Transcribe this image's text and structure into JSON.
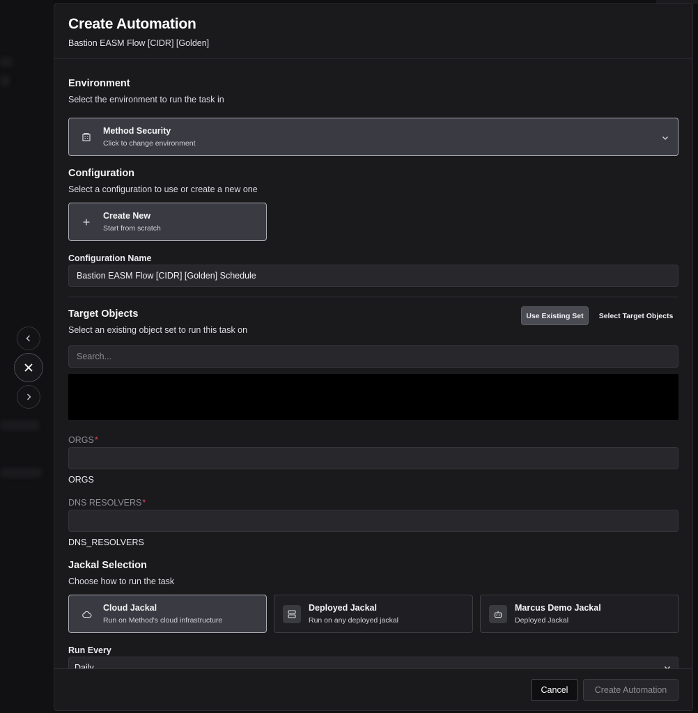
{
  "modal": {
    "title": "Create Automation",
    "subtitle": "Bastion EASM Flow [CIDR] [Golden]"
  },
  "environment": {
    "title": "Environment",
    "description": "Select the environment to run the task in",
    "selected_name": "Method Security",
    "selected_hint": "Click to change environment",
    "icon": "building-icon"
  },
  "configuration": {
    "title": "Configuration",
    "description": "Select a configuration to use or create a new one",
    "create_title": "Create New",
    "create_sub": "Start from scratch",
    "name_label": "Configuration Name",
    "name_value": "Bastion EASM Flow [CIDR] [Golden] Schedule"
  },
  "target_objects": {
    "title": "Target Objects",
    "description": "Select an existing object set to run this task on",
    "tab_existing": "Use Existing Set",
    "tab_select": "Select Target Objects",
    "search_placeholder": "Search..."
  },
  "params": {
    "orgs_label": "ORGS",
    "orgs_required": "*",
    "orgs_key": "ORGS",
    "dns_label": "DNS RESOLVERS",
    "dns_required": "*",
    "dns_key": "DNS_RESOLVERS"
  },
  "jackal": {
    "title": "Jackal Selection",
    "description": "Choose how to run the task",
    "options": [
      {
        "title": "Cloud Jackal",
        "sub": "Run on Method's cloud infrastructure",
        "icon": "cloud-icon"
      },
      {
        "title": "Deployed Jackal",
        "sub": "Run on any deployed jackal",
        "icon": "server-icon"
      },
      {
        "title": "Marcus Demo Jackal",
        "sub": "Deployed Jackal",
        "icon": "bot-icon"
      }
    ]
  },
  "schedule": {
    "label": "Run Every",
    "value": "Daily"
  },
  "footer": {
    "cancel": "Cancel",
    "create": "Create Automation"
  },
  "colors": {
    "modal_bg": "#1a1a1d",
    "selected_card": "#3a3a42",
    "required": "#e0445a"
  }
}
